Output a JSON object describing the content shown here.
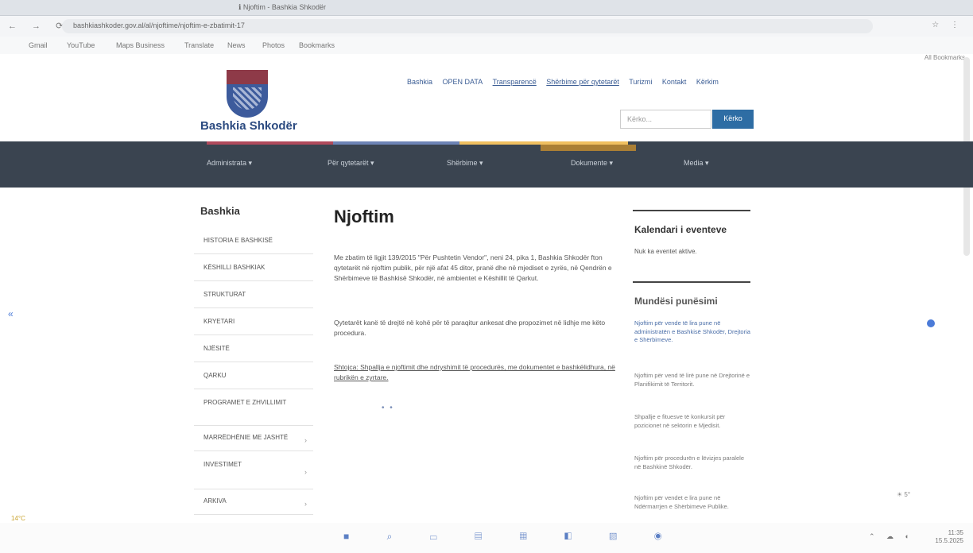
{
  "browser": {
    "tab_title": "ℹ Njoftim - Bashkia Shkodër",
    "url": "bashkiashkoder.gov.al/al/njoftime/njoftim-e-zbatimit-17",
    "bookmarks": [
      "Gmail",
      "YouTube",
      "Maps Business",
      "Translate",
      "News",
      "Photos",
      "Bookmarks"
    ],
    "all_bookmarks": "All Bookmarks"
  },
  "header": {
    "logo_text": "Bashkia Shkodër",
    "top_links": [
      "Bashkia",
      "OPEN DATA",
      "Transparencë",
      "Shërbime për qytetarët",
      "Turizmi",
      "Kontakt",
      "Kërkim"
    ],
    "search_placeholder": "Kërko...",
    "search_button": "Kërko"
  },
  "nav": {
    "items": [
      "Administrata ▾",
      "Për qytetarët ▾",
      "Shërbime ▾",
      "Dokumente ▾",
      "Media ▾"
    ]
  },
  "sidebar": {
    "title": "Bashkia",
    "items": [
      "HISTORIA E BASHKISË",
      "KËSHILLI BASHKIAK",
      "STRUKTURAT",
      "KRYETARI",
      "NJËSITË",
      "QARKU",
      "PROGRAMET E ZHVILLIMIT",
      "MARRËDHËNIE ME JASHTË",
      "INVESTIMET",
      "ARKIVA"
    ]
  },
  "main": {
    "title": "Njoftim",
    "p1": "Me zbatim të ligjit 139/2015 \"Për Pushtetin Vendor\", neni 24, pika 1, Bashkia Shkodër fton qytetarët në njoftim publik, për një afat 45 ditor, pranë dhe në mjediset e zyrës, në Qendrën e Shërbimeve të Bashkisë Shkodër, në ambientet e Këshillit të Qarkut.",
    "p2": "Qytetarët kanë të drejtë në kohë për të paraqitur ankesat dhe propozimet në lidhje me këto procedura.",
    "p3": "Shtojca: Shpallja e njoftimit dhe ndryshimit të procedurës, me dokumentet e bashkëlidhura, në rubrikën e zyrtare."
  },
  "right": {
    "calendar_title": "Kalendari i eventeve",
    "calendar_note": "Nuk ka eventet aktive.",
    "jobs_title": "Mundësi punësimi",
    "jobs": [
      "Njoftim për vende të lira pune në administratën e Bashkisë Shkodër, Drejtoria e Shërbimeve.",
      "Njoftim për vend të lirë pune në Drejtorinë e Planifikimit të Territorit.",
      "Shpallje e fituesve të konkursit për pozicionet në sektorin e Mjedisit.",
      "Njoftim për procedurën e lëvizjes paralele në Bashkinë Shkodër.",
      "Njoftim për vendet e lira pune në Ndërmarrjen e Shërbimeve Publike."
    ]
  },
  "taskbar": {
    "time": "11:35",
    "date": "15.5.2025",
    "weather_left": "14°C",
    "weather_right": "☀ 5°"
  },
  "colors": {
    "navbar": "#3a4450",
    "accent": "#2e6da4",
    "brand": "#2b4a80"
  }
}
